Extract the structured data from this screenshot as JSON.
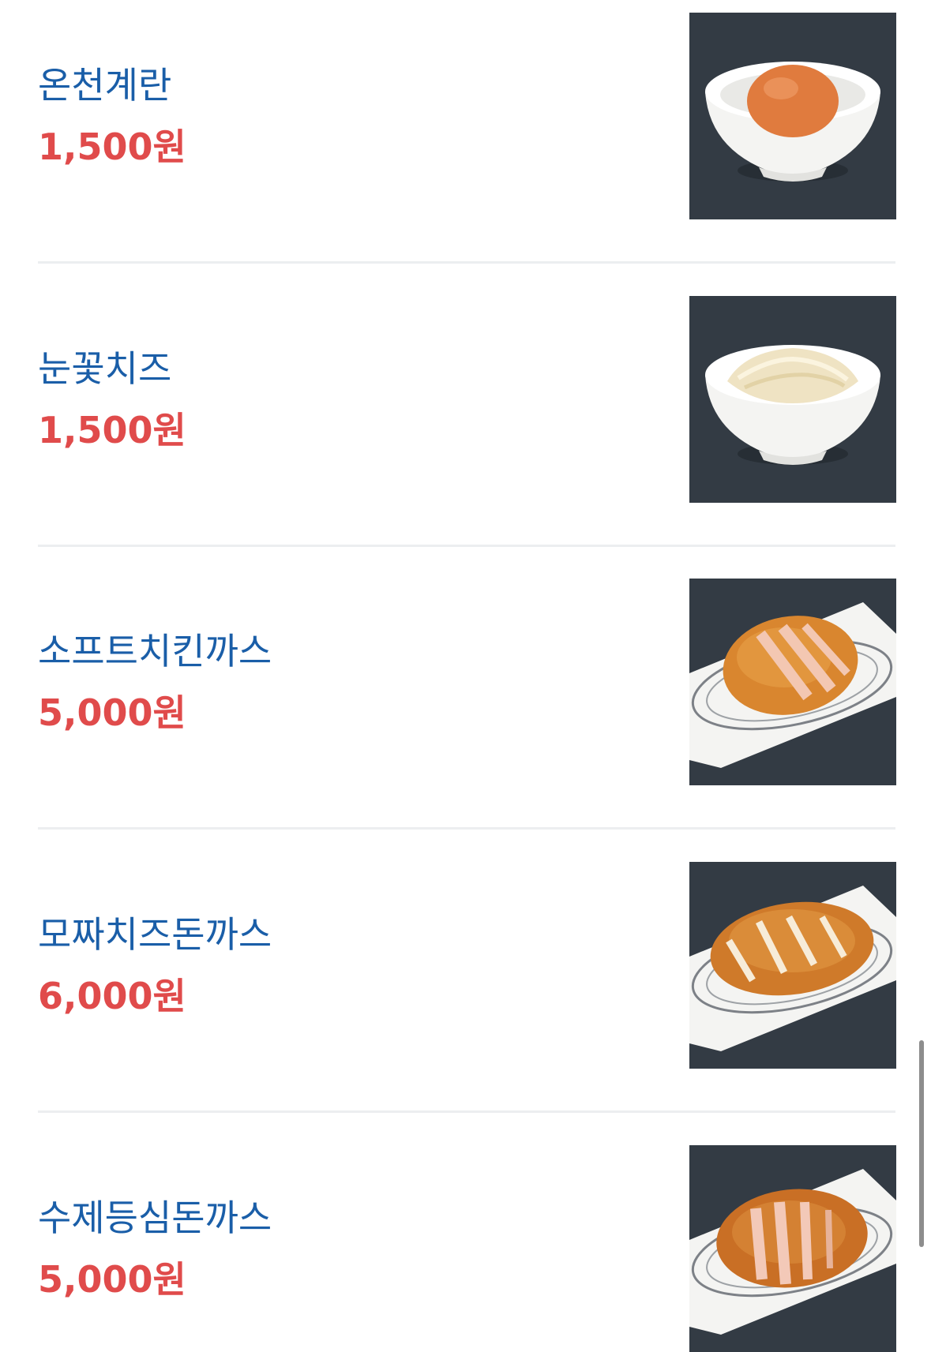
{
  "menu": {
    "items": [
      {
        "name": "온천계란",
        "price": "1,500원",
        "image": "egg-bowl-image"
      },
      {
        "name": "눈꽃치즈",
        "price": "1,500원",
        "image": "cheese-bowl-image"
      },
      {
        "name": "소프트치킨까스",
        "price": "5,000원",
        "image": "chicken-cutlet-image"
      },
      {
        "name": "모짜치즈돈까스",
        "price": "6,000원",
        "image": "cheese-pork-cutlet-image"
      },
      {
        "name": "수제등심돈까스",
        "price": "5,000원",
        "image": "pork-loin-cutlet-image"
      }
    ]
  },
  "colors": {
    "name_text": "#1a5ea8",
    "price_text": "#e04b4b",
    "divider": "#eceef0",
    "photo_background": "#2f3740"
  }
}
